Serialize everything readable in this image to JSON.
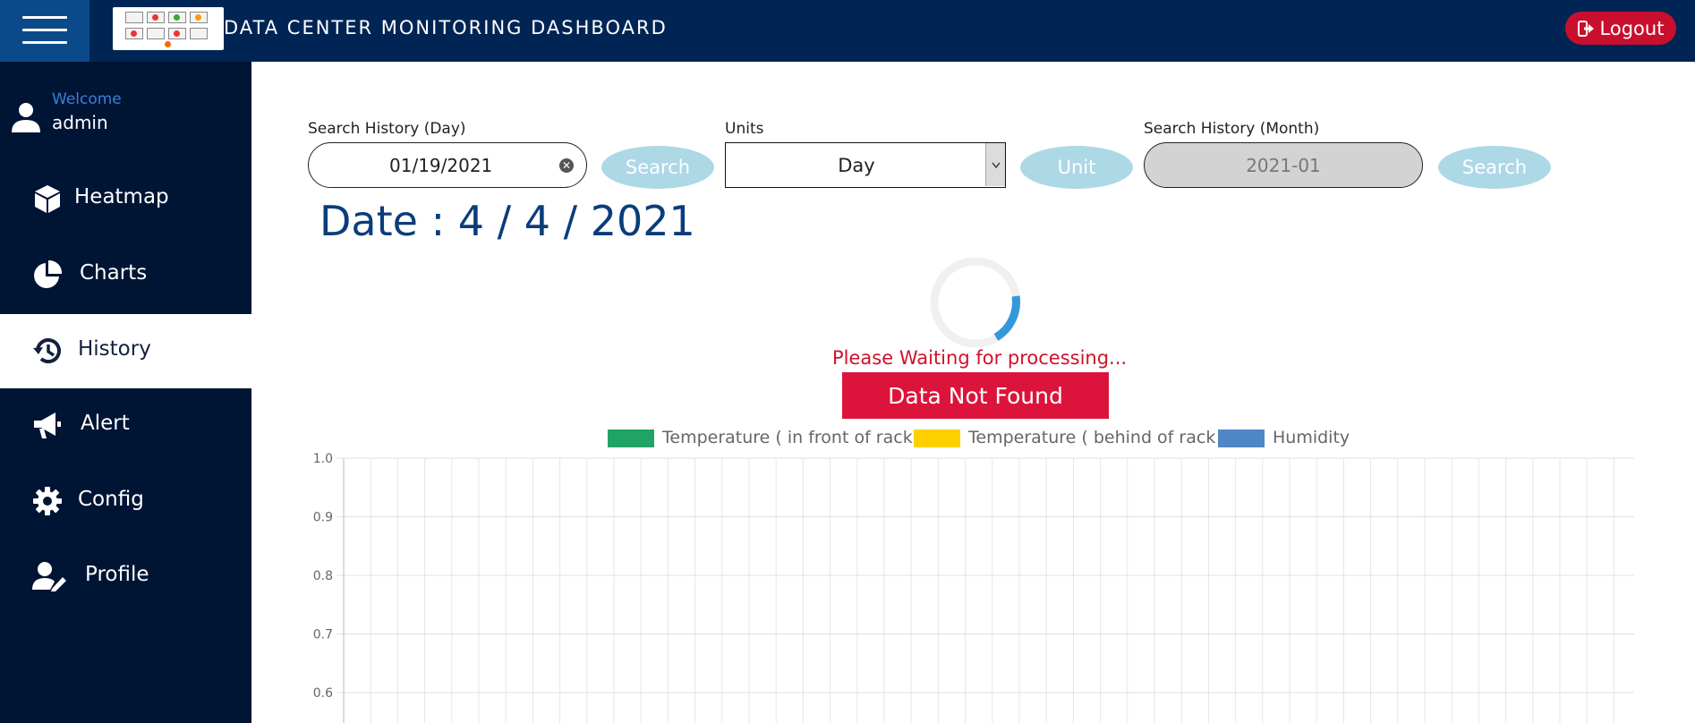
{
  "header": {
    "title": "DATA CENTER MONITORING DASHBOARD",
    "logout_label": "Logout"
  },
  "sidebar": {
    "welcome": "Welcome",
    "username": "admin",
    "items": [
      {
        "label": "Heatmap",
        "icon": "cube-icon",
        "active": false
      },
      {
        "label": "Charts",
        "icon": "pie-chart-icon",
        "active": false
      },
      {
        "label": "History",
        "icon": "history-icon",
        "active": true
      },
      {
        "label": "Alert",
        "icon": "megaphone-icon",
        "active": false
      },
      {
        "label": "Config",
        "icon": "gear-icon",
        "active": false
      },
      {
        "label": "Profile",
        "icon": "user-edit-icon",
        "active": false
      }
    ]
  },
  "search": {
    "day_label": "Search History (Day)",
    "day_value": "01/19/2021",
    "day_button": "Search",
    "units_label": "Units",
    "units_value": "Day",
    "unit_button": "Unit",
    "month_label": "Search History (Month)",
    "month_value": "2021-01",
    "month_button": "Search"
  },
  "status": {
    "date_heading": "Date : 4 / 4 / 2021",
    "waiting": "Please Waiting for processing...",
    "not_found": "Data Not Found"
  },
  "colors": {
    "header_bg": "#002554",
    "sidebar_bg": "#001434",
    "accent_red": "#dc143c",
    "button_light_blue": "#add8e6"
  },
  "chart_data": {
    "type": "line",
    "series": [
      {
        "name": "Temperature ( in front of rack )",
        "color": "#21a366",
        "values": []
      },
      {
        "name": "Temperature ( behind of rack )",
        "color": "#ffd000",
        "values": []
      },
      {
        "name": "Humidity",
        "color": "#4f86c6",
        "values": []
      }
    ],
    "y_ticks": [
      "1.0",
      "0.9",
      "0.8",
      "0.7",
      "0.6"
    ],
    "ylim": [
      0.6,
      1.0
    ],
    "grid": true,
    "legend": "top"
  }
}
